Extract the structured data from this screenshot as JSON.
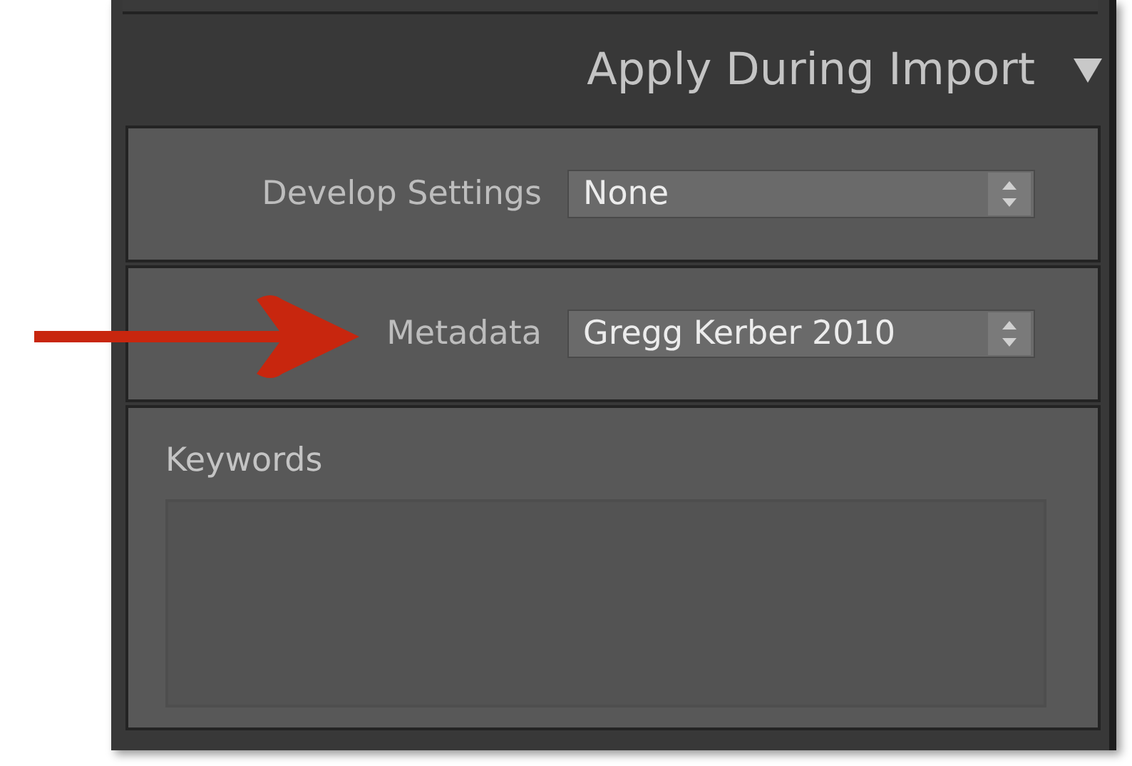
{
  "panel": {
    "title": "Apply During Import",
    "expanded": true
  },
  "rows": [
    {
      "label": "Develop Settings",
      "value": "None",
      "pointed": false
    },
    {
      "label": "Metadata",
      "value": "Gregg Kerber 2010",
      "pointed": true
    }
  ],
  "keywords": {
    "label": "Keywords"
  }
}
